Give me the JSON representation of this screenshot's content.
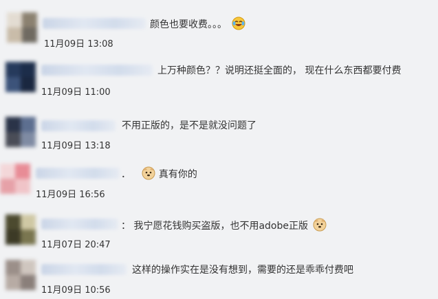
{
  "comments": [
    {
      "text": "颜色也要收费。。。",
      "time": "11月09日 13:08",
      "emoji": "laughing-tears-icon"
    },
    {
      "text": "上万种颜色？？说明还挺全面的，  现在什么东西都要付费",
      "time": "11月09日 11:00"
    },
    {
      "text": "不用正版的，是不是就没问题了",
      "time": "11月09日 13:18"
    },
    {
      "text": "．",
      "text2": "真有你的",
      "time": "11月09日 16:56",
      "emoji": "doge-icon"
    },
    {
      "text": "：  我宁愿花钱购买盗版，也不用adobe正版",
      "time": "11月07日 20:47",
      "emoji": "doge-icon"
    },
    {
      "text": "这样的操作实在是没有想到，需要的还是乖乖付费吧",
      "time": "11月09日 10:56"
    }
  ]
}
